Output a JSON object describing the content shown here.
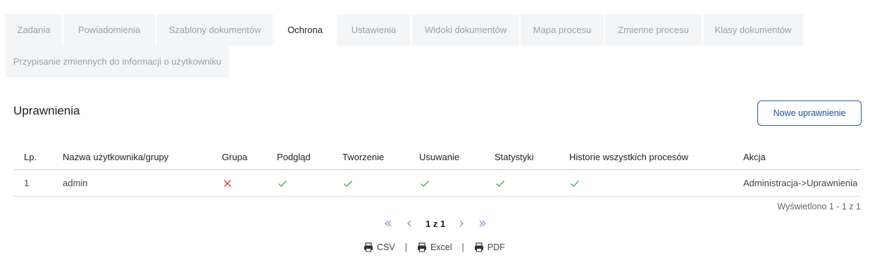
{
  "tabs_row1": [
    {
      "label": "Zadania",
      "width": 80,
      "active": false
    },
    {
      "label": "Powiadomienia",
      "width": 130,
      "active": false
    },
    {
      "label": "Szablony dokumentów",
      "width": 166,
      "active": false
    },
    {
      "label": "Ochrona",
      "width": 86,
      "active": true
    },
    {
      "label": "Ustawienia",
      "width": 105,
      "active": false
    },
    {
      "label": "Widoki dokumentów",
      "width": 152,
      "active": false
    },
    {
      "label": "Mapa procesu",
      "width": 118,
      "active": false
    },
    {
      "label": "Zmienne procesu",
      "width": 137,
      "active": false
    },
    {
      "label": "Klasy dokumentów",
      "width": 142,
      "active": false
    }
  ],
  "tabs_row2": [
    {
      "label": "Przypisanie zmiennych do informacji o użytkowniku",
      "width": 317,
      "active": false
    }
  ],
  "section": {
    "title": "Uprawnienia",
    "new_button": "Nowe uprawnienie"
  },
  "table": {
    "headers": {
      "lp": "Lp.",
      "name": "Nazwa użytkownika/grupy",
      "grupa": "Grupa",
      "podglad": "Podgląd",
      "tworzenie": "Tworzenie",
      "usuwanie": "Usuwanie",
      "statystyki": "Statystyki",
      "historie": "Historie wszystkich procesów",
      "akcja": "Akcja"
    },
    "rows": [
      {
        "lp": "1",
        "name": "admin",
        "grupa": false,
        "podglad": true,
        "tworzenie": true,
        "usuwanie": true,
        "statystyki": true,
        "historie": true,
        "akcja": "Administracja->Uprawnienia"
      }
    ]
  },
  "shown_text": "Wyświetlono 1 - 1 z 1",
  "pagination": {
    "info": "1 z 1",
    "first_icon": "double-chevron-left-icon",
    "prev_icon": "chevron-left-icon",
    "next_icon": "chevron-right-icon",
    "last_icon": "double-chevron-right-icon"
  },
  "exports": {
    "csv": "CSV",
    "excel": "Excel",
    "pdf": "PDF",
    "separator": "|",
    "icon": "printer-icon"
  },
  "colors": {
    "check": "#3aa85a",
    "cross": "#e53935",
    "accent": "#2a5fb0",
    "tab_bg": "#f4f5f6"
  }
}
